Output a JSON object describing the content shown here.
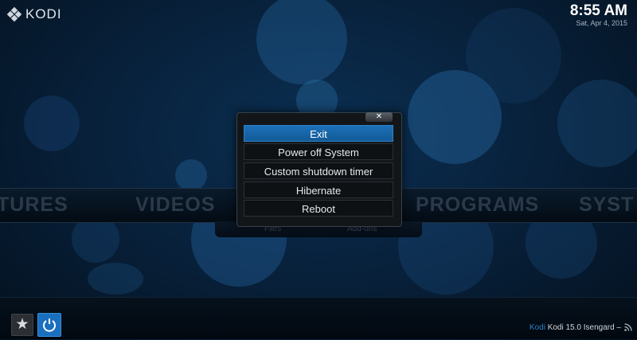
{
  "header": {
    "logo_text": "KODI",
    "time": "8:55 AM",
    "date": "Sat, Apr 4, 2015"
  },
  "main_menu": {
    "items": [
      "TURES",
      "VIDEOS",
      "PROGRAMS",
      "SYST"
    ]
  },
  "sub_menu": {
    "items": [
      "Files",
      "Add-ons"
    ]
  },
  "dialog": {
    "close_label": "✕",
    "options": [
      "Exit",
      "Power off System",
      "Custom shutdown timer",
      "Hibernate",
      "Reboot"
    ],
    "focused_option": "Exit"
  },
  "footer": {
    "brand": "Kodi",
    "version": "Kodi 15.0 Isengard –",
    "favourites_icon": "star-icon",
    "power_icon": "power-icon",
    "feed_icon": "rss-icon"
  },
  "colors": {
    "accent": "#1a6fbf",
    "focus": "#1d71b8",
    "background": "#08223d"
  }
}
